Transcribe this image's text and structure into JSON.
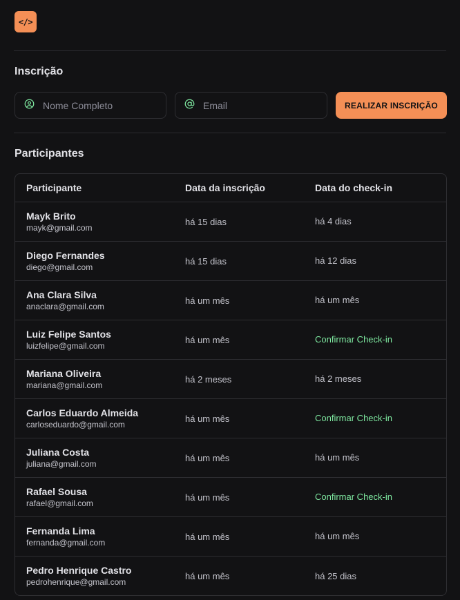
{
  "logo": {
    "glyph": "</>",
    "color": "#f48f56"
  },
  "registration": {
    "title": "Inscrição",
    "name_placeholder": "Nome Completo",
    "name_value": "",
    "email_placeholder": "Email",
    "email_value": "",
    "submit_label": "REALIZAR INSCRIÇÃO"
  },
  "participants": {
    "title": "Participantes",
    "columns": [
      "Participante",
      "Data da inscrição",
      "Data do check-in"
    ],
    "rows": [
      {
        "name": "Mayk Brito",
        "email": "mayk@gmail.com",
        "registered": "há 15 dias",
        "checkin": "há 4 dias"
      },
      {
        "name": "Diego Fernandes",
        "email": "diego@gmail.com",
        "registered": "há 15 dias",
        "checkin": "há 12 dias"
      },
      {
        "name": "Ana Clara Silva",
        "email": "anaclara@gmail.com",
        "registered": "há um mês",
        "checkin": "há um mês"
      },
      {
        "name": "Luiz Felipe Santos",
        "email": "luizfelipe@gmail.com",
        "registered": "há um mês",
        "checkin": "Confirmar Check-in"
      },
      {
        "name": "Mariana Oliveira",
        "email": "mariana@gmail.com",
        "registered": "há 2 meses",
        "checkin": "há 2 meses"
      },
      {
        "name": "Carlos Eduardo Almeida",
        "email": "carloseduardo@gmail.com",
        "registered": "há um mês",
        "checkin": "Confirmar Check-in"
      },
      {
        "name": "Juliana Costa",
        "email": "juliana@gmail.com",
        "registered": "há um mês",
        "checkin": "há um mês"
      },
      {
        "name": "Rafael Sousa",
        "email": "rafael@gmail.com",
        "registered": "há um mês",
        "checkin": "Confirmar Check-in"
      },
      {
        "name": "Fernanda Lima",
        "email": "fernanda@gmail.com",
        "registered": "há um mês",
        "checkin": "há um mês"
      },
      {
        "name": "Pedro Henrique Castro",
        "email": "pedrohenrique@gmail.com",
        "registered": "há um mês",
        "checkin": "há 25 dias"
      }
    ]
  },
  "colors": {
    "background": "#121214",
    "accent": "#f48f56",
    "confirm_link": "#7ee8a0",
    "icon": "#7ee8a0"
  },
  "icons": {
    "name_field": "user-circle-icon",
    "email_field": "at-sign-icon"
  }
}
